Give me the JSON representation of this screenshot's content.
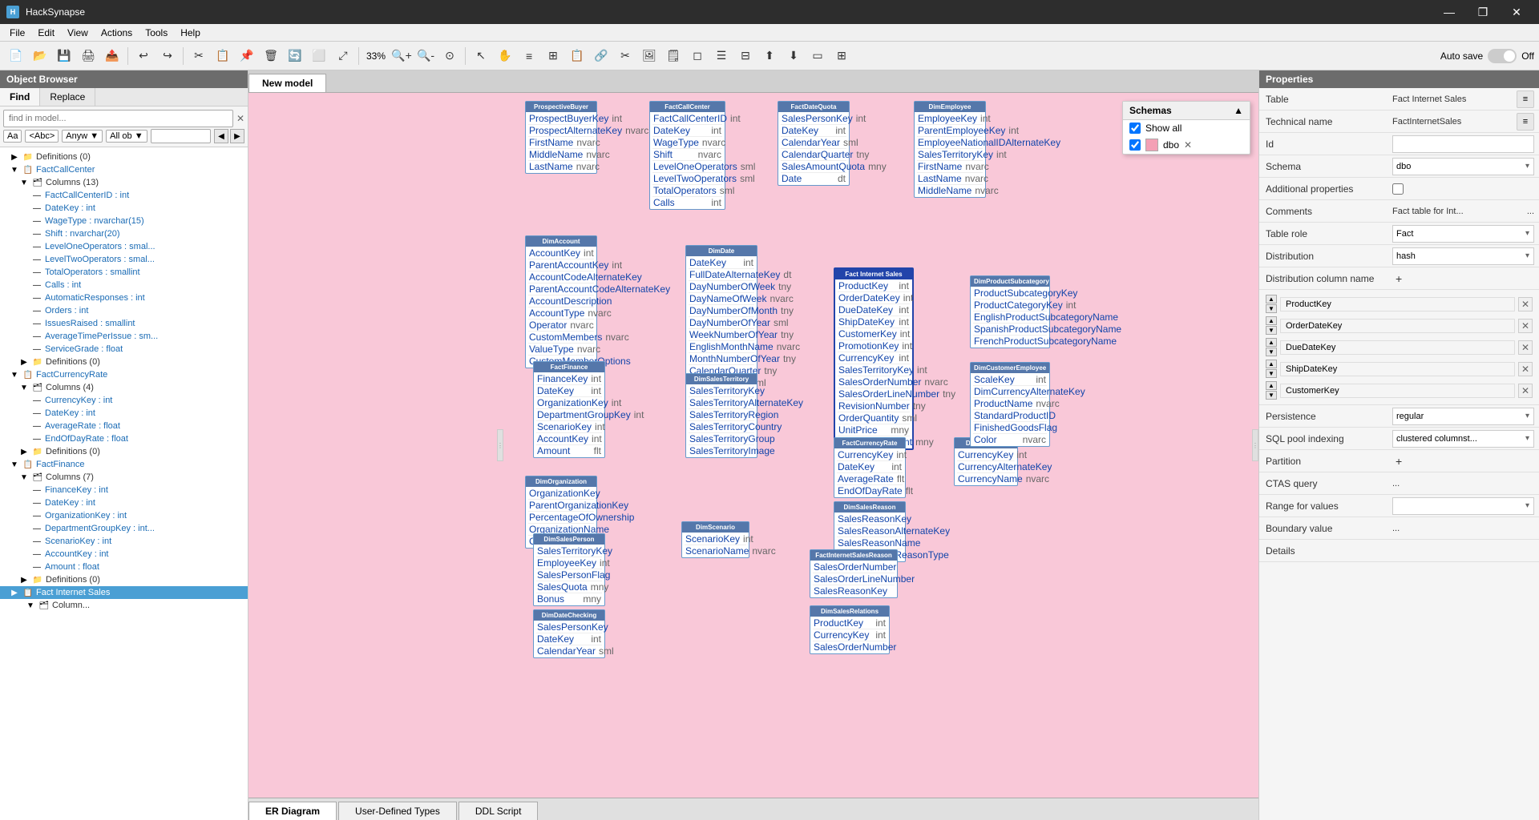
{
  "app": {
    "name": "HackSynapse",
    "title": "HackSynapse"
  },
  "titlebar": {
    "title": "HackSynapse",
    "minimize": "—",
    "restore": "❐",
    "close": "✕"
  },
  "menubar": {
    "items": [
      "File",
      "Edit",
      "View",
      "Actions",
      "Tools",
      "Help"
    ]
  },
  "toolbar": {
    "zoom_label": "33%",
    "autosave_label": "Auto save",
    "autosave_state": "Off"
  },
  "object_browser": {
    "header": "Object Browser",
    "tabs": [
      "Find",
      "Replace"
    ],
    "active_tab": "Find",
    "search_placeholder": "find in model...",
    "options": [
      "Aa",
      "<Abc>",
      "Anyw ▼",
      "All ob ▼"
    ],
    "tree": [
      {
        "level": 0,
        "type": "folder",
        "label": "Definitions (0)",
        "expanded": false
      },
      {
        "level": 0,
        "type": "folder",
        "label": "FactCallCenter",
        "expanded": true,
        "link": true
      },
      {
        "level": 1,
        "type": "folder",
        "label": "Columns (13)",
        "expanded": true
      },
      {
        "level": 2,
        "type": "item",
        "label": "FactCallCenterID : int",
        "link": true
      },
      {
        "level": 2,
        "type": "item",
        "label": "DateKey : int",
        "link": true
      },
      {
        "level": 2,
        "type": "item",
        "label": "WageType : nvarchar(15)",
        "link": true
      },
      {
        "level": 2,
        "type": "item",
        "label": "Shift : nvarchar(20)",
        "link": true
      },
      {
        "level": 2,
        "type": "item",
        "label": "LevelOneOperators : smal...",
        "link": true
      },
      {
        "level": 2,
        "type": "item",
        "label": "LevelTwoOperators : smal...",
        "link": true
      },
      {
        "level": 2,
        "type": "item",
        "label": "TotalOperators : smallint",
        "link": true
      },
      {
        "level": 2,
        "type": "item",
        "label": "Calls : int",
        "link": true
      },
      {
        "level": 2,
        "type": "item",
        "label": "AutomaticResponses : int",
        "link": true
      },
      {
        "level": 2,
        "type": "item",
        "label": "Orders : int",
        "link": true
      },
      {
        "level": 2,
        "type": "item",
        "label": "IssuesRaised : smallint",
        "link": true
      },
      {
        "level": 2,
        "type": "item",
        "label": "AverageTimePerIssue : sm...",
        "link": true
      },
      {
        "level": 2,
        "type": "item",
        "label": "ServiceGrade : float",
        "link": true
      },
      {
        "level": 1,
        "type": "folder",
        "label": "Definitions (0)",
        "expanded": false
      },
      {
        "level": 0,
        "type": "folder",
        "label": "FactCurrencyRate",
        "expanded": true,
        "link": true
      },
      {
        "level": 1,
        "type": "folder",
        "label": "Columns (4)",
        "expanded": true
      },
      {
        "level": 2,
        "type": "item",
        "label": "CurrencyKey : int",
        "link": true
      },
      {
        "level": 2,
        "type": "item",
        "label": "DateKey : int",
        "link": true
      },
      {
        "level": 2,
        "type": "item",
        "label": "AverageRate : float",
        "link": true
      },
      {
        "level": 2,
        "type": "item",
        "label": "EndOfDayRate : float",
        "link": true
      },
      {
        "level": 1,
        "type": "folder",
        "label": "Definitions (0)",
        "expanded": false
      },
      {
        "level": 0,
        "type": "folder",
        "label": "FactFinance",
        "expanded": true,
        "link": true
      },
      {
        "level": 1,
        "type": "folder",
        "label": "Columns (7)",
        "expanded": true
      },
      {
        "level": 2,
        "type": "item",
        "label": "FinanceKey : int",
        "link": true
      },
      {
        "level": 2,
        "type": "item",
        "label": "DateKey : int",
        "link": true
      },
      {
        "level": 2,
        "type": "item",
        "label": "OrganizationKey : int",
        "link": true
      },
      {
        "level": 2,
        "type": "item",
        "label": "DepartmentGroupKey : int...",
        "link": true
      },
      {
        "level": 2,
        "type": "item",
        "label": "ScenarioKey : int",
        "link": true
      },
      {
        "level": 2,
        "type": "item",
        "label": "AccountKey : int",
        "link": true
      },
      {
        "level": 2,
        "type": "item",
        "label": "Amount : float",
        "link": true
      },
      {
        "level": 1,
        "type": "folder",
        "label": "Definitions (0)",
        "expanded": false
      },
      {
        "level": 0,
        "type": "folder",
        "label": "Fact Internet Sales",
        "expanded": false,
        "link": true,
        "selected": true
      }
    ]
  },
  "canvas": {
    "tab_label": "New model",
    "bottom_tabs": [
      "ER Diagram",
      "User-Defined Types",
      "DDL Script"
    ],
    "active_bottom_tab": "ER Diagram"
  },
  "schemas": {
    "title": "Schemas",
    "show_all_label": "Show all",
    "show_all_checked": true,
    "items": [
      {
        "name": "dbo",
        "checked": true,
        "color": "#f4a0b5"
      }
    ]
  },
  "properties": {
    "header": "Properties",
    "rows": [
      {
        "label": "Table",
        "type": "text-icon",
        "value": "Fact Internet Sales"
      },
      {
        "label": "Technical name",
        "type": "text-icon",
        "value": "FactInternetSales"
      },
      {
        "label": "Id",
        "type": "input",
        "value": ""
      },
      {
        "label": "Schema",
        "type": "select",
        "value": "dbo"
      },
      {
        "label": "Additional properties",
        "type": "checkbox",
        "checked": false
      },
      {
        "label": "Comments",
        "type": "text-ellipsis",
        "value": "Fact table for Int... ..."
      },
      {
        "label": "Table role",
        "type": "select",
        "value": "Fact"
      },
      {
        "label": "Distribution",
        "type": "select",
        "value": "hash"
      },
      {
        "label": "Distribution column name",
        "type": "plus",
        "value": ""
      }
    ],
    "dist_keys": [
      {
        "name": "ProductKey"
      },
      {
        "name": "OrderDateKey"
      },
      {
        "name": "DueDateKey"
      },
      {
        "name": "ShipDateKey"
      },
      {
        "name": "CustomerKey"
      }
    ],
    "lower_rows": [
      {
        "label": "Persistence",
        "type": "select",
        "value": "regular"
      },
      {
        "label": "SQL pool indexing",
        "type": "select",
        "value": "clustered columnst..."
      },
      {
        "label": "Partition",
        "type": "plus",
        "value": ""
      },
      {
        "label": "CTAS query",
        "type": "ellipsis",
        "value": "..."
      },
      {
        "label": "Range for values",
        "type": "select",
        "value": ""
      },
      {
        "label": "Boundary value",
        "type": "ellipsis",
        "value": "..."
      },
      {
        "label": "Details",
        "type": "text",
        "value": ""
      }
    ]
  }
}
